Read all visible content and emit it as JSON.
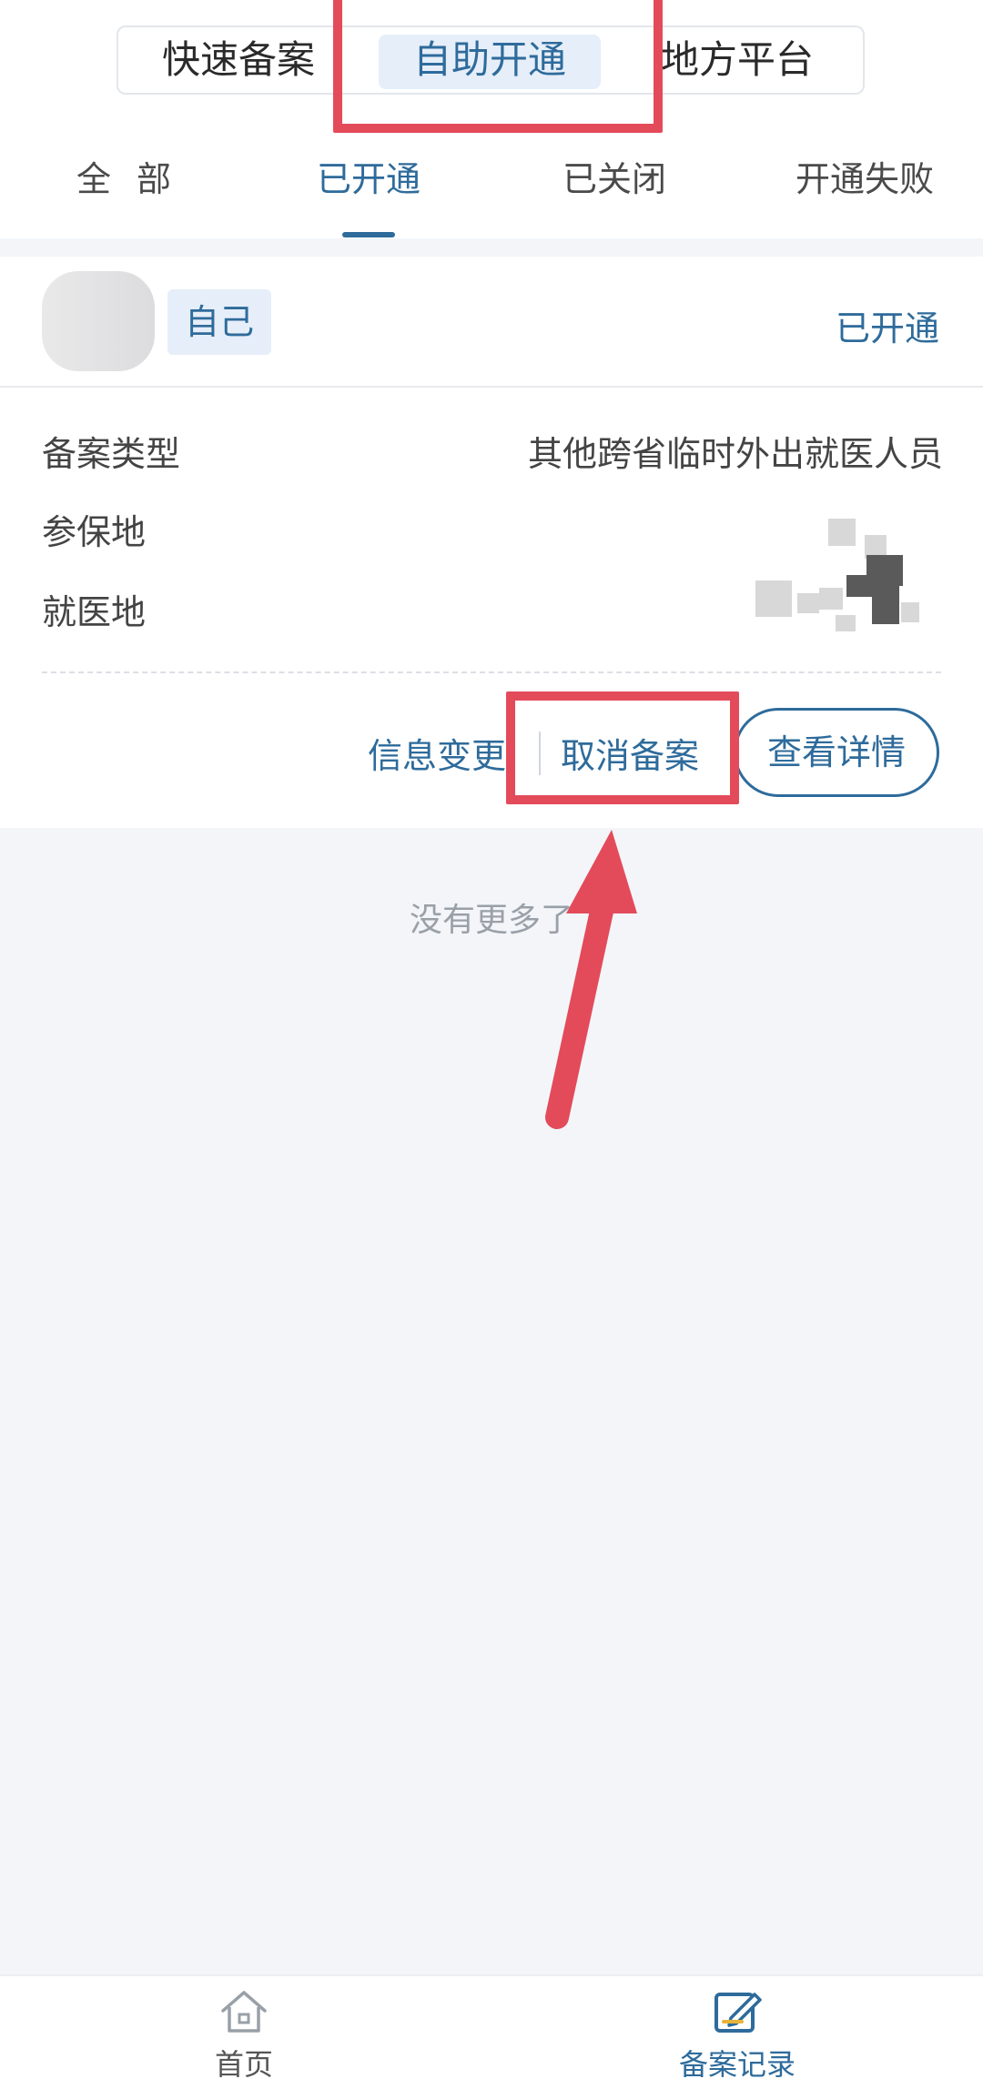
{
  "top_segments": [
    {
      "label": "快速备案"
    },
    {
      "label": "自助开通"
    },
    {
      "label": "地方平台"
    }
  ],
  "tabs": [
    {
      "label": "全 部"
    },
    {
      "label": "已开通"
    },
    {
      "label": "已关闭"
    },
    {
      "label": "开通失败"
    }
  ],
  "record": {
    "relation_tag": "自己",
    "status": "已开通",
    "fields": [
      {
        "label": "备案类型",
        "value": "其他跨省临时外出就医人员"
      },
      {
        "label": "参保地",
        "value": ""
      },
      {
        "label": "就医地",
        "value": ""
      }
    ],
    "actions": {
      "info_change": "信息变更",
      "cancel": "取消备案",
      "detail": "查看详情"
    }
  },
  "list_end_text": "没有更多了",
  "bottom_nav": [
    {
      "label": "首页",
      "icon": "home-icon"
    },
    {
      "label": "备案记录",
      "icon": "record-edit-icon"
    }
  ],
  "colors": {
    "accent": "#2e6b9b",
    "highlight": "#e34b5a",
    "background": "#f3f5f9"
  }
}
